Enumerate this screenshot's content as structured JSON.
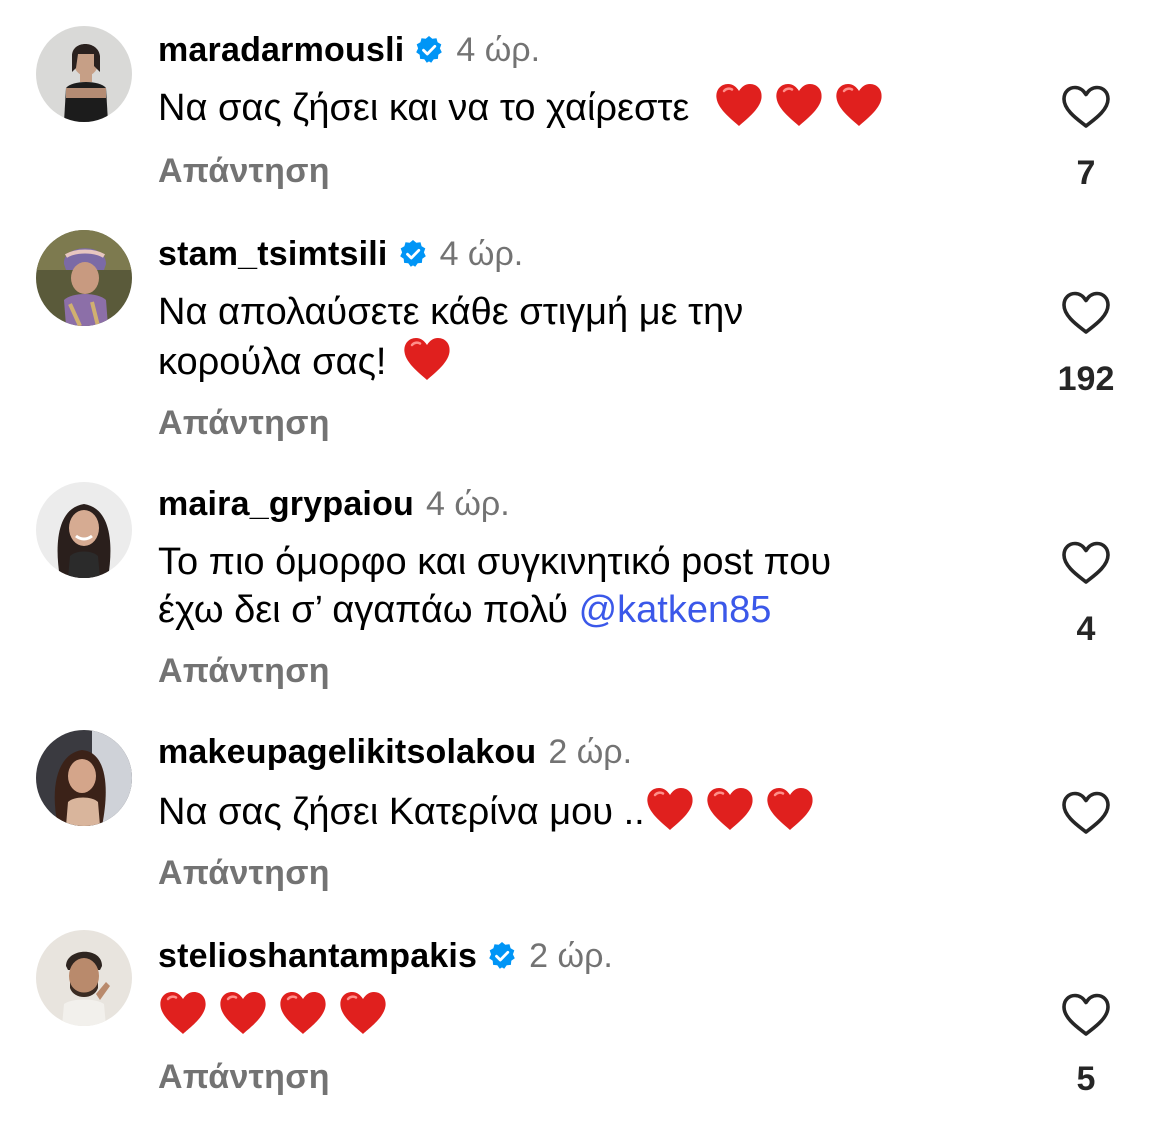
{
  "reply_label": "Απάντηση",
  "colors": {
    "text": "#000000",
    "secondary": "#737373",
    "mention": "#3b58e9",
    "verified": "#0095f6",
    "heart": "#e0201e"
  },
  "comments": [
    {
      "username": "maradarmousli",
      "verified": true,
      "time": "4 ώρ.",
      "text": "Να σας ζήσει και να το χαίρεστε",
      "emoji": "red-heart x3",
      "likes": "7"
    },
    {
      "username": "stam_tsimtsili",
      "verified": true,
      "time": "4 ώρ.",
      "text_line1": "Να απολαύσετε κάθε στιγμή με την",
      "text_line2": "κορούλα σας!",
      "emoji": "red-heart x1",
      "likes": "192"
    },
    {
      "username": "maira_grypaiou",
      "verified": false,
      "time": "4 ώρ.",
      "text_line1": "Το πιο όμορφο και συγκινητικό post που",
      "text_line2": "έχω δει σ’ αγαπάω πολύ",
      "mention": "@katken85",
      "likes": "4"
    },
    {
      "username": "makeupagelikitsolakou",
      "verified": false,
      "time": "2 ώρ.",
      "text": "Να σας ζήσει Κατερίνα μου ..",
      "emoji": "red-heart x3",
      "likes": ""
    },
    {
      "username": "stelioshantampakis",
      "verified": true,
      "time": "2 ώρ.",
      "emoji": "red-heart x4",
      "likes": "5"
    }
  ]
}
